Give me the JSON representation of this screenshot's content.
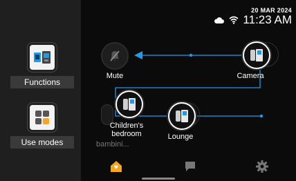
{
  "sidebar": {
    "functions_label": "Functions",
    "use_modes_label": "Use modes"
  },
  "status": {
    "date": "20 MAR 2024",
    "time": "11:23 AM",
    "icons": [
      "cloud-icon",
      "wifi-icon"
    ]
  },
  "devices": {
    "mute_label": "Mute",
    "camera_label": "Camera",
    "childrens_bedroom_label_line1": "Children's",
    "childrens_bedroom_label_line2": "bedroom",
    "bambini_label": "bambini...",
    "lounge_label": "Lounge"
  },
  "nav": {
    "items": [
      "home-icon",
      "chat-icon",
      "settings-icon"
    ],
    "active": "home-icon"
  },
  "colors": {
    "accent_blue": "#1e9be9",
    "home_orange": "#f5a623",
    "sidebar_bg": "#1f1f1f",
    "label_bg": "#3a3a3a"
  }
}
